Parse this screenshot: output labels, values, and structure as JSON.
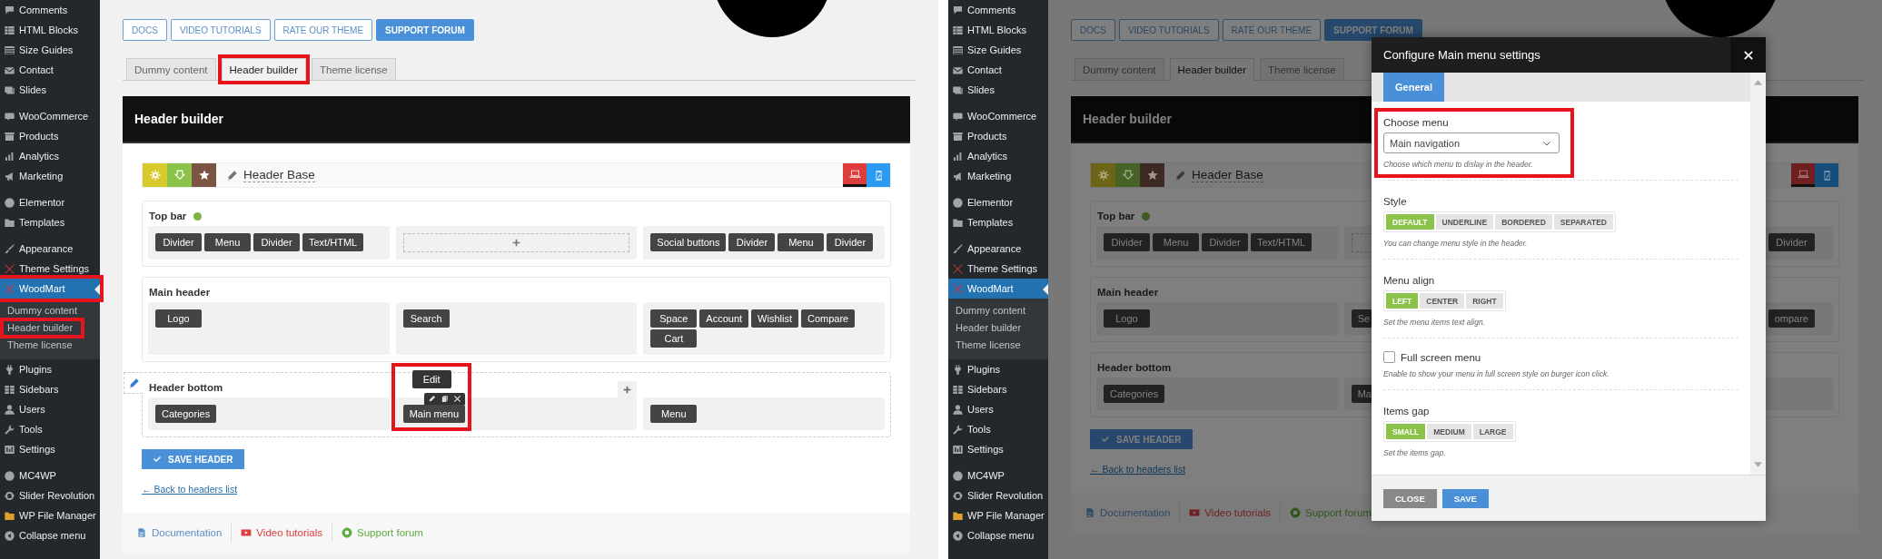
{
  "screens": [
    {
      "sidebar": {
        "groups": [
          [
            {
              "label": "Comments",
              "selected": false,
              "highlighted": false
            },
            {
              "label": "HTML Blocks",
              "selected": false,
              "highlighted": false
            },
            {
              "label": "Size Guides",
              "selected": false,
              "highlighted": false
            },
            {
              "label": "Contact",
              "selected": false,
              "highlighted": false
            },
            {
              "label": "Slides",
              "selected": false,
              "highlighted": false
            }
          ],
          [
            {
              "label": "WooCommerce",
              "selected": false,
              "highlighted": false
            },
            {
              "label": "Products",
              "selected": false,
              "highlighted": false
            },
            {
              "label": "Analytics",
              "selected": false,
              "highlighted": false
            },
            {
              "label": "Marketing",
              "selected": false,
              "highlighted": false
            }
          ],
          [
            {
              "label": "Elementor",
              "selected": false,
              "highlighted": false
            },
            {
              "label": "Templates",
              "selected": false,
              "highlighted": false
            }
          ],
          [
            {
              "label": "Appearance",
              "selected": false,
              "highlighted": false
            },
            {
              "label": "Theme Settings",
              "selected": false,
              "highlighted": false
            },
            {
              "label": "WoodMart",
              "selected": true,
              "highlighted": true,
              "children": [
                {
                  "label": "Dummy content",
                  "selected": false,
                  "highlighted": false
                },
                {
                  "label": "Header builder",
                  "selected": false,
                  "highlighted": true
                },
                {
                  "label": "Theme license",
                  "selected": false,
                  "highlighted": false
                }
              ]
            },
            {
              "label": "Plugins",
              "selected": false,
              "highlighted": false
            },
            {
              "label": "Sidebars",
              "selected": false,
              "highlighted": false
            },
            {
              "label": "Users",
              "selected": false,
              "highlighted": false
            },
            {
              "label": "Tools",
              "selected": false,
              "highlighted": false
            },
            {
              "label": "Settings",
              "selected": false,
              "highlighted": false
            }
          ],
          [
            {
              "label": "MC4WP",
              "selected": false,
              "highlighted": false
            },
            {
              "label": "Slider Revolution",
              "selected": false,
              "highlighted": false
            },
            {
              "label": "WP File Manager",
              "selected": false,
              "highlighted": false
            },
            {
              "label": "Collapse menu",
              "selected": false,
              "highlighted": false
            }
          ]
        ]
      },
      "top_buttons": [
        {
          "label": "DOCS",
          "kind": "outline"
        },
        {
          "label": "VIDEO TUTORIALS",
          "kind": "outline"
        },
        {
          "label": "RATE OUR THEME",
          "kind": "outline"
        },
        {
          "label": "SUPPORT FORUM",
          "kind": "filled"
        }
      ],
      "tabs": [
        {
          "label": "Dummy content",
          "selected": false,
          "highlighted": false
        },
        {
          "label": "Header builder",
          "selected": true,
          "highlighted": true
        },
        {
          "label": "Theme license",
          "selected": false,
          "highlighted": false
        }
      ],
      "builder": {
        "title": "Header builder",
        "header_name": "Header Base",
        "tools": [
          {
            "color": "#d8c92c"
          },
          {
            "color": "#8bc34a"
          },
          {
            "color": "#7b5444"
          }
        ],
        "devices": [
          {
            "color": "#dd3d3d",
            "selected": true
          },
          {
            "color": "#2b9af3",
            "selected": false
          }
        ],
        "rows": [
          {
            "label": "Top bar",
            "status_dot": true,
            "hover": false,
            "columns": [
              {
                "items": [
                  {
                    "label": "Divider"
                  },
                  {
                    "label": "Menu"
                  },
                  {
                    "label": "Divider"
                  },
                  {
                    "label": "Text/HTML"
                  }
                ]
              },
              {
                "add_slot": true
              },
              {
                "items": [
                  {
                    "label": "Social buttons"
                  },
                  {
                    "label": "Divider"
                  },
                  {
                    "label": "Menu"
                  },
                  {
                    "label": "Divider"
                  }
                ]
              }
            ]
          },
          {
            "label": "Main header",
            "status_dot": false,
            "hover": false,
            "columns": [
              {
                "items": [
                  {
                    "label": "Logo"
                  }
                ]
              },
              {
                "items": [
                  {
                    "label": "Search"
                  }
                ]
              },
              {
                "items": [
                  {
                    "label": "Space"
                  },
                  {
                    "label": "Account"
                  },
                  {
                    "label": "Wishlist"
                  },
                  {
                    "label": "Compare"
                  },
                  {
                    "label": "Cart"
                  }
                ]
              }
            ]
          },
          {
            "label": "Header bottom",
            "status_dot": false,
            "hover": true,
            "columns": [
              {
                "items": [
                  {
                    "label": "Categories"
                  }
                ]
              },
              {
                "items": [
                  {
                    "label": "Main menu",
                    "tooltip": "Edit",
                    "highlighted": true
                  }
                ]
              },
              {
                "items": [
                  {
                    "label": "Menu"
                  }
                ]
              }
            ]
          }
        ],
        "save_button": "SAVE HEADER",
        "back_link": "← Back to headers list",
        "footer_links": [
          {
            "label": "Documentation",
            "color": "#5b8fc7"
          },
          {
            "label": "Video tutorials",
            "color": "#dd3d3d"
          },
          {
            "label": "Support forum",
            "color": "#5cae3c"
          }
        ]
      }
    },
    {
      "sidebar": {
        "groups": [
          [
            {
              "label": "Comments",
              "selected": false,
              "highlighted": false
            },
            {
              "label": "HTML Blocks",
              "selected": false,
              "highlighted": false
            },
            {
              "label": "Size Guides",
              "selected": false,
              "highlighted": false
            },
            {
              "label": "Contact",
              "selected": false,
              "highlighted": false
            },
            {
              "label": "Slides",
              "selected": false,
              "highlighted": false
            }
          ],
          [
            {
              "label": "WooCommerce",
              "selected": false,
              "highlighted": false
            },
            {
              "label": "Products",
              "selected": false,
              "highlighted": false
            },
            {
              "label": "Analytics",
              "selected": false,
              "highlighted": false
            },
            {
              "label": "Marketing",
              "selected": false,
              "highlighted": false
            }
          ],
          [
            {
              "label": "Elementor",
              "selected": false,
              "highlighted": false
            },
            {
              "label": "Templates",
              "selected": false,
              "highlighted": false
            }
          ],
          [
            {
              "label": "Appearance",
              "selected": false,
              "highlighted": false
            },
            {
              "label": "Theme Settings",
              "selected": false,
              "highlighted": false
            },
            {
              "label": "WoodMart",
              "selected": true,
              "highlighted": false,
              "children": [
                {
                  "label": "Dummy content",
                  "selected": false,
                  "highlighted": false
                },
                {
                  "label": "Header builder",
                  "selected": false,
                  "highlighted": false
                },
                {
                  "label": "Theme license",
                  "selected": false,
                  "highlighted": false
                }
              ]
            },
            {
              "label": "Plugins",
              "selected": false,
              "highlighted": false
            },
            {
              "label": "Sidebars",
              "selected": false,
              "highlighted": false
            },
            {
              "label": "Users",
              "selected": false,
              "highlighted": false
            },
            {
              "label": "Tools",
              "selected": false,
              "highlighted": false
            },
            {
              "label": "Settings",
              "selected": false,
              "highlighted": false
            }
          ],
          [
            {
              "label": "MC4WP",
              "selected": false,
              "highlighted": false
            },
            {
              "label": "Slider Revolution",
              "selected": false,
              "highlighted": false
            },
            {
              "label": "WP File Manager",
              "selected": false,
              "highlighted": false
            },
            {
              "label": "Collapse menu",
              "selected": false,
              "highlighted": false
            }
          ]
        ]
      },
      "top_buttons": [
        {
          "label": "DOCS",
          "kind": "outline"
        },
        {
          "label": "VIDEO TUTORIALS",
          "kind": "outline"
        },
        {
          "label": "RATE OUR THEME",
          "kind": "outline"
        },
        {
          "label": "SUPPORT FORUM",
          "kind": "filled"
        }
      ],
      "tabs": [
        {
          "label": "Dummy content",
          "selected": false,
          "highlighted": false
        },
        {
          "label": "Header builder",
          "selected": true,
          "highlighted": false
        },
        {
          "label": "Theme license",
          "selected": false,
          "highlighted": false
        }
      ],
      "builder": {
        "title": "Header builder",
        "header_name": "Header Base",
        "tools": [
          {
            "color": "#6c6416"
          },
          {
            "color": "#466225"
          },
          {
            "color": "#3e2a22"
          }
        ],
        "devices": [
          {
            "color": "#6f1f1f",
            "selected": true
          },
          {
            "color": "#164d7a",
            "selected": false
          }
        ],
        "rows": [
          {
            "label": "Top bar",
            "status_dot": true,
            "hover": false,
            "columns": [
              {
                "items": [
                  {
                    "label": "Divider"
                  },
                  {
                    "label": "Menu"
                  },
                  {
                    "label": "Divider"
                  },
                  {
                    "label": "Text/HTML"
                  }
                ]
              },
              {
                "add_slot": true
              },
              {
                "items": [
                  {
                    "label": "Divider"
                  }
                ]
              }
            ]
          },
          {
            "label": "Main header",
            "status_dot": false,
            "hover": false,
            "columns": [
              {
                "items": [
                  {
                    "label": "Logo"
                  }
                ]
              },
              {
                "items": [
                  {
                    "label": "Se"
                  }
                ]
              },
              {
                "items": [
                  {
                    "label": "ompare"
                  }
                ]
              }
            ]
          },
          {
            "label": "Header bottom",
            "status_dot": false,
            "hover": false,
            "columns": [
              {
                "items": [
                  {
                    "label": "Categories"
                  }
                ]
              },
              {
                "items": [
                  {
                    "label": "Ma"
                  }
                ]
              },
              {}
            ]
          }
        ],
        "save_button": "SAVE HEADER",
        "back_link": "← Back to headers list",
        "footer_links": [
          {
            "label": "Documentation",
            "color": "#2e4864"
          },
          {
            "label": "Video tutorials",
            "color": "#6f1f1f"
          },
          {
            "label": "Support forum",
            "color": "#2e571e"
          }
        ]
      },
      "dialog": {
        "title": "Configure Main menu settings",
        "tabs": [
          {
            "label": "General",
            "selected": true
          }
        ],
        "fields": [
          {
            "kind": "select",
            "label": "Choose menu",
            "value": "Main navigation",
            "help": "Choose which menu to dislay in the header.",
            "highlighted": true
          },
          {
            "kind": "buttons",
            "label": "Style",
            "options": [
              {
                "label": "DEFAULT",
                "selected": true
              },
              {
                "label": "UNDERLINE",
                "selected": false
              },
              {
                "label": "BORDERED",
                "selected": false
              },
              {
                "label": "SEPARATED",
                "selected": false
              }
            ],
            "help": "You can change menu style in the header.",
            "highlighted": false
          },
          {
            "kind": "buttons",
            "label": "Menu align",
            "options": [
              {
                "label": "LEFT",
                "selected": true
              },
              {
                "label": "CENTER",
                "selected": false
              },
              {
                "label": "RIGHT",
                "selected": false
              }
            ],
            "help": "Set the menu items text align.",
            "highlighted": false
          },
          {
            "kind": "checkbox",
            "label": "Full screen menu",
            "checked": false,
            "help": "Enable to show your menu in full screen style on burger icon click.",
            "highlighted": false
          },
          {
            "kind": "buttons",
            "label": "Items gap",
            "options": [
              {
                "label": "SMALL",
                "selected": true
              },
              {
                "label": "MEDIUM",
                "selected": false
              },
              {
                "label": "LARGE",
                "selected": false
              }
            ],
            "help": "Set the items gap.",
            "highlighted": false
          }
        ],
        "buttons": [
          {
            "label": "CLOSE",
            "kind": "secondary"
          },
          {
            "label": "SAVE",
            "kind": "primary"
          }
        ]
      }
    }
  ]
}
